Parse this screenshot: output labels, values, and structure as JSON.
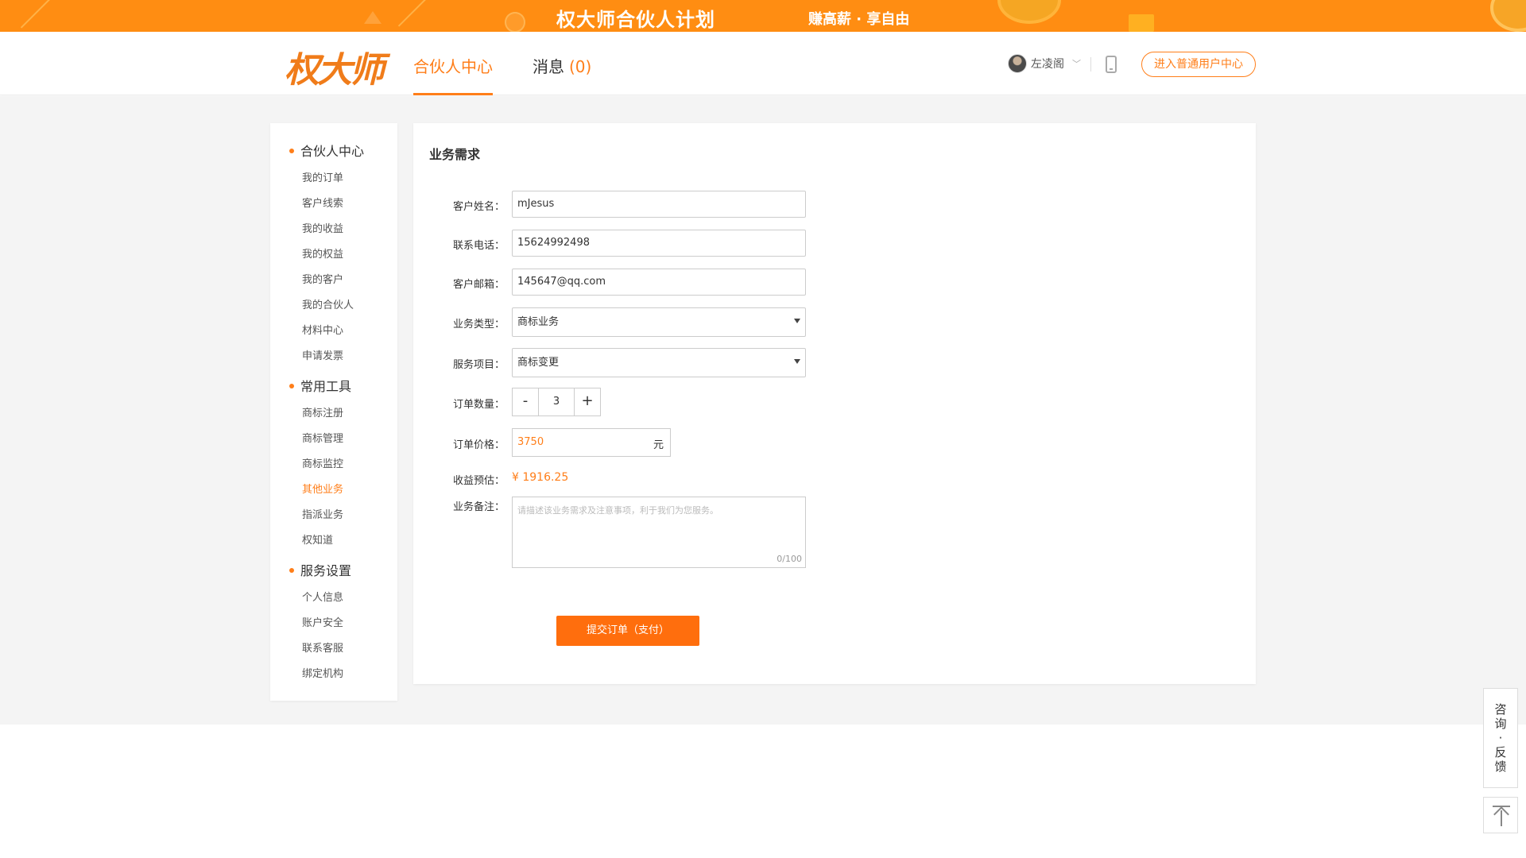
{
  "banner": {
    "title": "权大师合伙人计划",
    "slogan": "赚高薪 · 享自由"
  },
  "header": {
    "logo_text": "权大师",
    "tabs": [
      {
        "label": "合伙人中心",
        "active": true
      },
      {
        "label": "消息",
        "count": "(0)"
      }
    ],
    "user_name": "左凌阁",
    "enter_button": "进入普通用户中心"
  },
  "sidebar": {
    "groups": [
      {
        "title": "合伙人中心",
        "items": [
          "我的订单",
          "客户线索",
          "我的收益",
          "我的权益",
          "我的客户",
          "我的合伙人",
          "材料中心",
          "申请发票"
        ]
      },
      {
        "title": "常用工具",
        "items": [
          "商标注册",
          "商标管理",
          "商标监控",
          "其他业务",
          "指派业务",
          "权知道"
        ]
      },
      {
        "title": "服务设置",
        "items": [
          "个人信息",
          "账户安全",
          "联系客服",
          "绑定机构"
        ]
      }
    ],
    "active_item": "其他业务"
  },
  "form": {
    "title": "业务需求",
    "customer_name_label": "客户姓名：",
    "customer_name_value": "mJesus",
    "phone_label": "联系电话：",
    "phone_value": "15624992498",
    "email_label": "客户邮箱：",
    "email_value": "145647@qq.com",
    "business_type_label": "业务类型：",
    "business_type_value": "商标业务",
    "service_item_label": "服务项目：",
    "service_item_value": "商标变更",
    "quantity_label": "订单数量：",
    "quantity_minus": "-",
    "quantity_value": "3",
    "quantity_plus": "+",
    "price_label": "订单价格：",
    "price_value": "3750",
    "price_unit": "元",
    "earnings_label": "收益预估：",
    "earnings_value": "¥ 1916.25",
    "remark_label": "业务备注：",
    "remark_placeholder": "请描述该业务需求及注意事项，利于我们为您服务。",
    "remark_count": "0/100",
    "submit_label": "提交订单（支付）"
  },
  "floating": {
    "consult_chars": [
      "咨",
      "询",
      "·",
      "反",
      "馈"
    ]
  },
  "colors": {
    "accent": "#ff7e19",
    "banner": "#ff8d12",
    "submit": "#ff6e0d"
  }
}
